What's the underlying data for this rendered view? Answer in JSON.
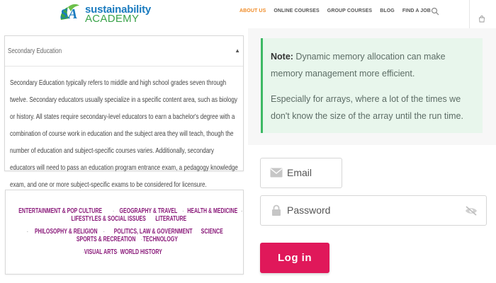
{
  "brand": {
    "mark": "SA",
    "name_line1": "sustainability",
    "name_line2": "ACADEMY",
    "colors": {
      "blue": "#1a7bbf",
      "green": "#3aa34a"
    }
  },
  "nav": {
    "items": [
      {
        "label": "ABOUT US",
        "active": true
      },
      {
        "label": "ONLINE COURSES",
        "active": false
      },
      {
        "label": "GROUP COURSES",
        "active": false
      },
      {
        "label": "BLOG",
        "active": false
      },
      {
        "label": "FIND A JOB",
        "active": false
      }
    ],
    "search_icon": "search-icon",
    "cart_icon": "cart-icon",
    "active_color": "#f08a24"
  },
  "accordion": {
    "title": "Secondary Education",
    "toggle": "▲",
    "body": "Secondary Education typically refers to middle and high school grades seven through twelve. Secondary educators usually specialize in a specific content area, such as biology or history. All states require secondary-level educators to earn a bachelor's degree with a combination of course work in education and the subject area they will teach, though the number of education and subject-specific courses varies. Additionally, secondary educators will need to pass an education program entrance exam, a pedagogy knowledge exam, and one or more subject-specific exams to be considered for licensure."
  },
  "categories": {
    "rows": [
      [
        "ENTERTAINMENT & POP CULTURE",
        "GEOGRAPHY & TRAVEL",
        "HEALTH & MEDICINE",
        "LIFESTYLES & SOCIAL ISSUES",
        "LITERATURE"
      ],
      [
        "PHILOSOPHY & RELIGION",
        "POLITICS, LAW & GOVERNMENT",
        "SCIENCE",
        "SPORTS & RECREATION",
        "TECHNOLOGY"
      ],
      [
        "VISUAL ARTS",
        "WORLD HISTORY"
      ]
    ],
    "separator": "·",
    "color": "#8a1a7a"
  },
  "note": {
    "label": "Note:",
    "text1": " Dynamic memory allocation can make memory management more efficient.",
    "text2": "Especially for arrays, where a lot of the times we don't know the size of the array until the run time.",
    "accent": "#3cb964"
  },
  "login": {
    "email_placeholder": "Email",
    "password_placeholder": "Password",
    "button_label": "Log in",
    "button_color": "#e0185a",
    "email_icon": "envelope-icon",
    "password_icon": "lock-icon",
    "visibility_icon": "eye-slash-icon"
  }
}
